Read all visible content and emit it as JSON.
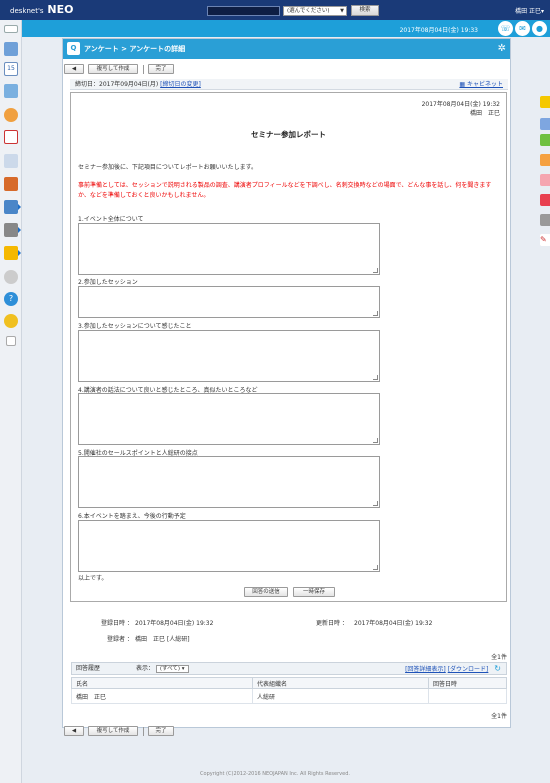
{
  "app": {
    "logo_main": "desknet's",
    "logo_sub": "NEO",
    "user_name": "橋田 正巳▾",
    "datetime": "2017年08月04日(金) 19:33"
  },
  "search": {
    "select_label": "(選んでください)",
    "button_label": "検索"
  },
  "header": {
    "breadcrumb": "アンケート > アンケートの詳細"
  },
  "toolbar": {
    "copy_label": "複写して作成",
    "done_label": "完了"
  },
  "deadline": {
    "label": "締切日：2017年09月04日(月)",
    "change_link": "[締切日の変更]",
    "cabinet_link": "キャビネット"
  },
  "doc": {
    "date": "2017年08月04日(金) 19:32",
    "author": "橋田　正巳",
    "title": "セミナー参加レポート",
    "intro": "セミナー参加後に、下記項目についてレポートお願いいたします。",
    "note": "事前準備としては、セッションで説明される製品の調査、講演者プロフィールなどを下調べし、名刺交換時などの場面で、どんな事を話し、何を聞きますか、などを準備しておくと良いかもしれません。",
    "questions": [
      "1.イベント全体について",
      "2.参加したセッション",
      "3.参加したセッションについて感じたこと",
      "4.講演者の話法について良いと感じたところ、真似たいところなど",
      "5.開催社のセールスポイントと人総研の接点",
      "6.本イベントを踏まえ、今後の行動予定"
    ],
    "closing": "以上です。",
    "send_label": "回答の送信",
    "save_label": "一時保存"
  },
  "meta": {
    "registered_label": "登録日時 ：",
    "registered_value": "2017年08月04日(金) 19:32",
    "updated_label": "更新日時 ：",
    "updated_value": "2017年08月04日(金) 19:32",
    "registrant_label": "登録者 ：",
    "registrant_value": "橋田　正巳 [人総研]",
    "count_top": "全1件",
    "count_bottom": "全1件"
  },
  "history": {
    "title": "回答履歴",
    "display_label": "表示：",
    "display_value": "(すべて)",
    "detail_link": "[回答詳細表示]",
    "download_link": "[ダウンロード]",
    "columns": [
      "氏名",
      "代表組織名",
      "回答日時"
    ],
    "rows": [
      [
        "橋田　正巳",
        "人総研",
        ""
      ]
    ]
  },
  "footer": {
    "copyright": "Copyright (C)2012-2016 NEOJAPAN Inc. All Rights Reserved."
  }
}
